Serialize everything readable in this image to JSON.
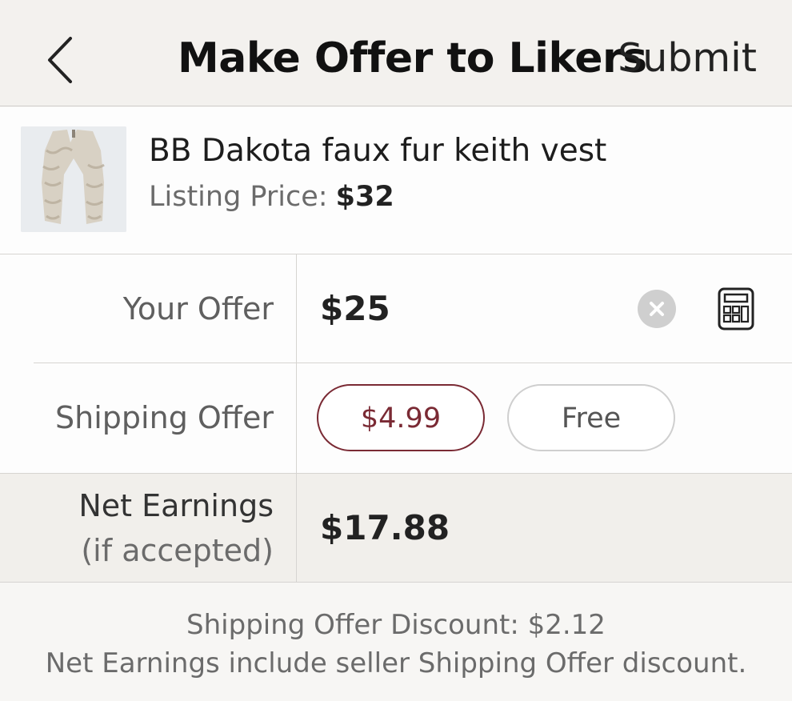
{
  "header": {
    "title": "Make Offer to Likers",
    "submit_label": "Submit"
  },
  "listing": {
    "title": "BB Dakota faux fur keith vest",
    "price_label": "Listing Price:",
    "price_value": "$32"
  },
  "offer": {
    "label": "Your Offer",
    "value": "$25"
  },
  "shipping": {
    "label": "Shipping Offer",
    "options": [
      {
        "label": "$4.99",
        "selected": true
      },
      {
        "label": "Free",
        "selected": false
      }
    ]
  },
  "net": {
    "label": "Net Earnings",
    "sublabel": "(if accepted)",
    "value": "$17.88"
  },
  "footer": {
    "line1": "Shipping Offer Discount: $2.12",
    "line2": "Net Earnings include seller Shipping Offer discount."
  },
  "colors": {
    "accent": "#7a2a34",
    "header_bg": "#f3f1ee",
    "net_bg": "#f1efeb"
  },
  "icons": {
    "back": "chevron-left-icon",
    "clear": "clear-circle-icon",
    "calculator": "calculator-icon"
  }
}
